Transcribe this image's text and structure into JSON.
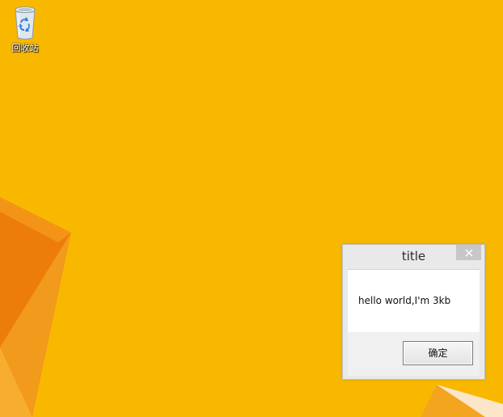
{
  "desktop": {
    "background_color": "#f9b800",
    "icons": [
      {
        "label": "回收站",
        "icon": "recycle-bin-icon"
      }
    ]
  },
  "dialog": {
    "title": "title",
    "close_glyph": "✕",
    "message": "hello world,I'm 3kb",
    "ok_label": "确定"
  }
}
